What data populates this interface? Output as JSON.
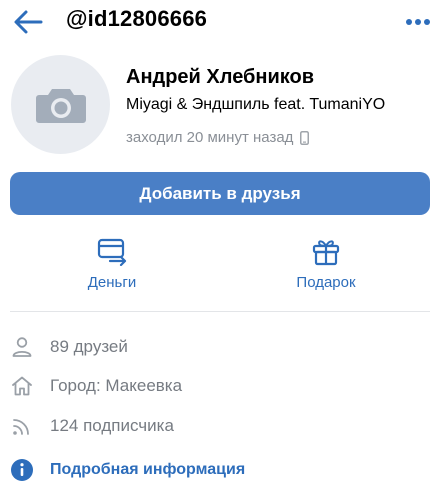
{
  "header": {
    "title": "@id12806666"
  },
  "profile": {
    "name": "Андрей Хлебников",
    "status": "Miyagi & Эндшпиль feat. TumaniYO",
    "last_seen": "заходил 20 минут назад"
  },
  "actions": {
    "add_friend": "Добавить в друзья",
    "money": "Деньги",
    "gift": "Подарок"
  },
  "info": {
    "friends": "89 друзей",
    "city": "Город: Макеевка",
    "subscribers": "124 подписчика",
    "details": "Подробная информация"
  },
  "icons": {
    "back": "arrow-left-icon",
    "more": "more-dots-icon",
    "avatar": "camera-icon",
    "device": "phone-icon",
    "money": "card-transfer-icon",
    "gift": "gift-icon",
    "friends": "user-icon",
    "city": "home-icon",
    "subscribers": "rss-icon",
    "details": "info-icon"
  },
  "colors": {
    "accent": "#2d6dbb",
    "button": "#4a7fc6",
    "muted": "#767b82",
    "avatar_bg": "#e9ecf1"
  }
}
